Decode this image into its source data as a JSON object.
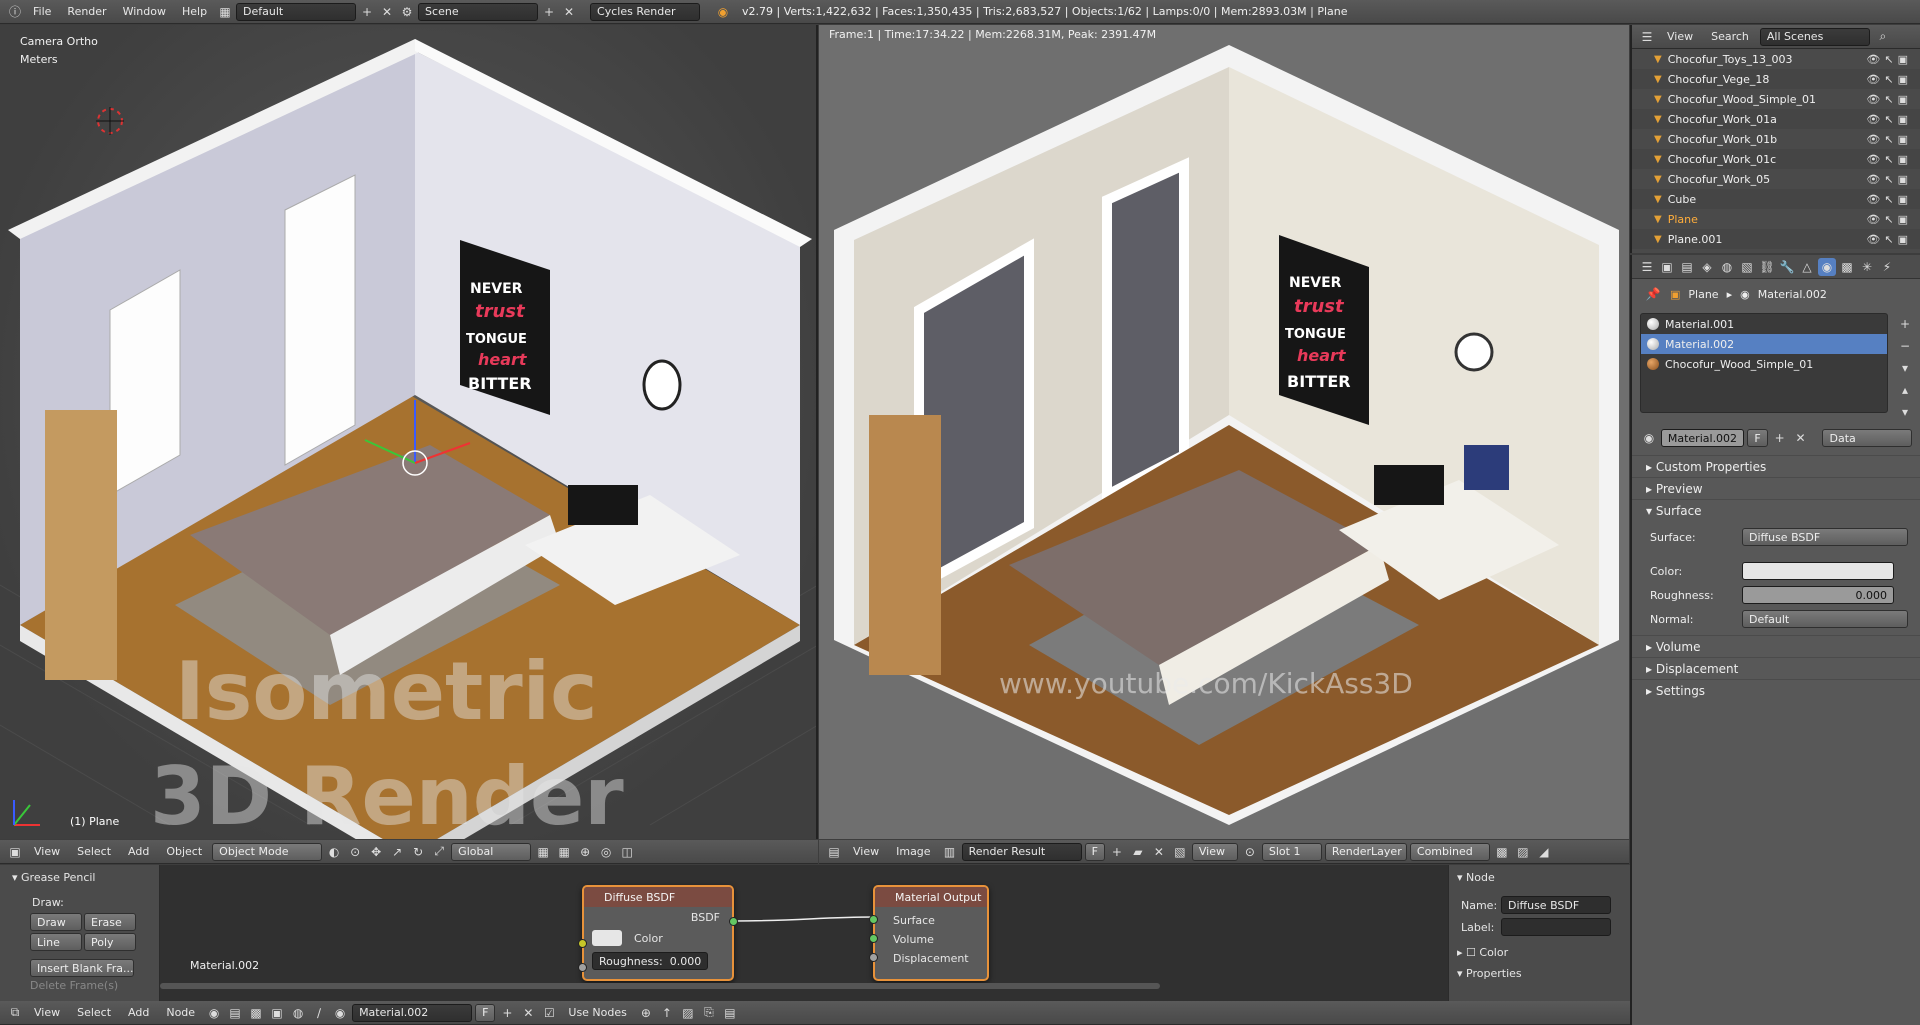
{
  "topbar": {
    "menus": [
      "File",
      "Render",
      "Window",
      "Help"
    ],
    "layout": "Default",
    "scene": "Scene",
    "engine": "Cycles Render",
    "stats": "v2.79 | Verts:1,422,632 | Faces:1,350,435 | Tris:2,683,527 | Objects:1/62 | Lamps:0/0 | Mem:2893.03M | Plane"
  },
  "viewport3d": {
    "view_name": "Camera Ortho",
    "units": "Meters",
    "object_label": "(1) Plane",
    "watermark_line1": "Isometric",
    "watermark_line2": "3D Render",
    "poster_lines": [
      "NEVER",
      "trust",
      "TONGUE",
      "heart",
      "BITTER"
    ],
    "header": {
      "menus": [
        "View",
        "Select",
        "Add",
        "Object"
      ],
      "mode": "Object Mode",
      "orientation": "Global"
    }
  },
  "render_view": {
    "info": "Frame:1 | Time:17:34.22 | Mem:2268.31M, Peak: 2391.47M",
    "watermark": "www.youtube.com/KickAss3D",
    "header": {
      "menus": [
        "View",
        "Image"
      ],
      "image": "Render Result",
      "f_label": "F",
      "view": "View",
      "slot": "Slot 1",
      "layer": "RenderLayer",
      "pass": "Combined"
    }
  },
  "outliner": {
    "menus": [
      "View",
      "Search"
    ],
    "filter": "All Scenes",
    "items": [
      "Chocofur_Toys_13_003",
      "Chocofur_Vege_18",
      "Chocofur_Wood_Simple_01",
      "Chocofur_Work_01a",
      "Chocofur_Work_01b",
      "Chocofur_Work_01c",
      "Chocofur_Work_05",
      "Cube",
      "Plane",
      "Plane.001"
    ],
    "selected": "Plane"
  },
  "properties": {
    "breadcrumb_object": "Plane",
    "breadcrumb_material": "Material.002",
    "materials": [
      "Material.001",
      "Material.002",
      "Chocofur_Wood_Simple_01"
    ],
    "selected_material": "Material.002",
    "material_field": "Material.002",
    "f_label": "F",
    "link": "Data",
    "panels": [
      "Custom Properties",
      "Preview",
      "Surface",
      "Volume",
      "Displacement",
      "Settings"
    ],
    "surface_label": "Surface:",
    "surface_value": "Diffuse BSDF",
    "color_label": "Color:",
    "roughness_label": "Roughness:",
    "roughness_value": "0.000",
    "normal_label": "Normal:",
    "normal_value": "Default"
  },
  "tools": {
    "panel": "Grease Pencil",
    "draw_label": "Draw:",
    "draw": "Draw",
    "erase": "Erase",
    "line": "Line",
    "poly": "Poly",
    "insert": "Insert Blank Fra...",
    "delete": "Delete Frame(s)"
  },
  "node_editor": {
    "material_label": "Material.002",
    "diffuse": {
      "title": "Diffuse BSDF",
      "output": "BSDF",
      "color": "Color",
      "roughness_label": "Roughness:",
      "roughness_value": "0.000"
    },
    "output": {
      "title": "Material Output",
      "surface": "Surface",
      "volume": "Volume",
      "displacement": "Displacement"
    }
  },
  "node_props": {
    "panel": "Node",
    "name_label": "Name:",
    "name_value": "Diffuse BSDF",
    "label_label": "Label:",
    "color_panel": "Color",
    "properties_panel": "Properties"
  },
  "bottombar": {
    "menus": [
      "View",
      "Select",
      "Add",
      "Node"
    ],
    "material": "Material.002",
    "f_label": "F",
    "use_nodes": "Use Nodes"
  }
}
